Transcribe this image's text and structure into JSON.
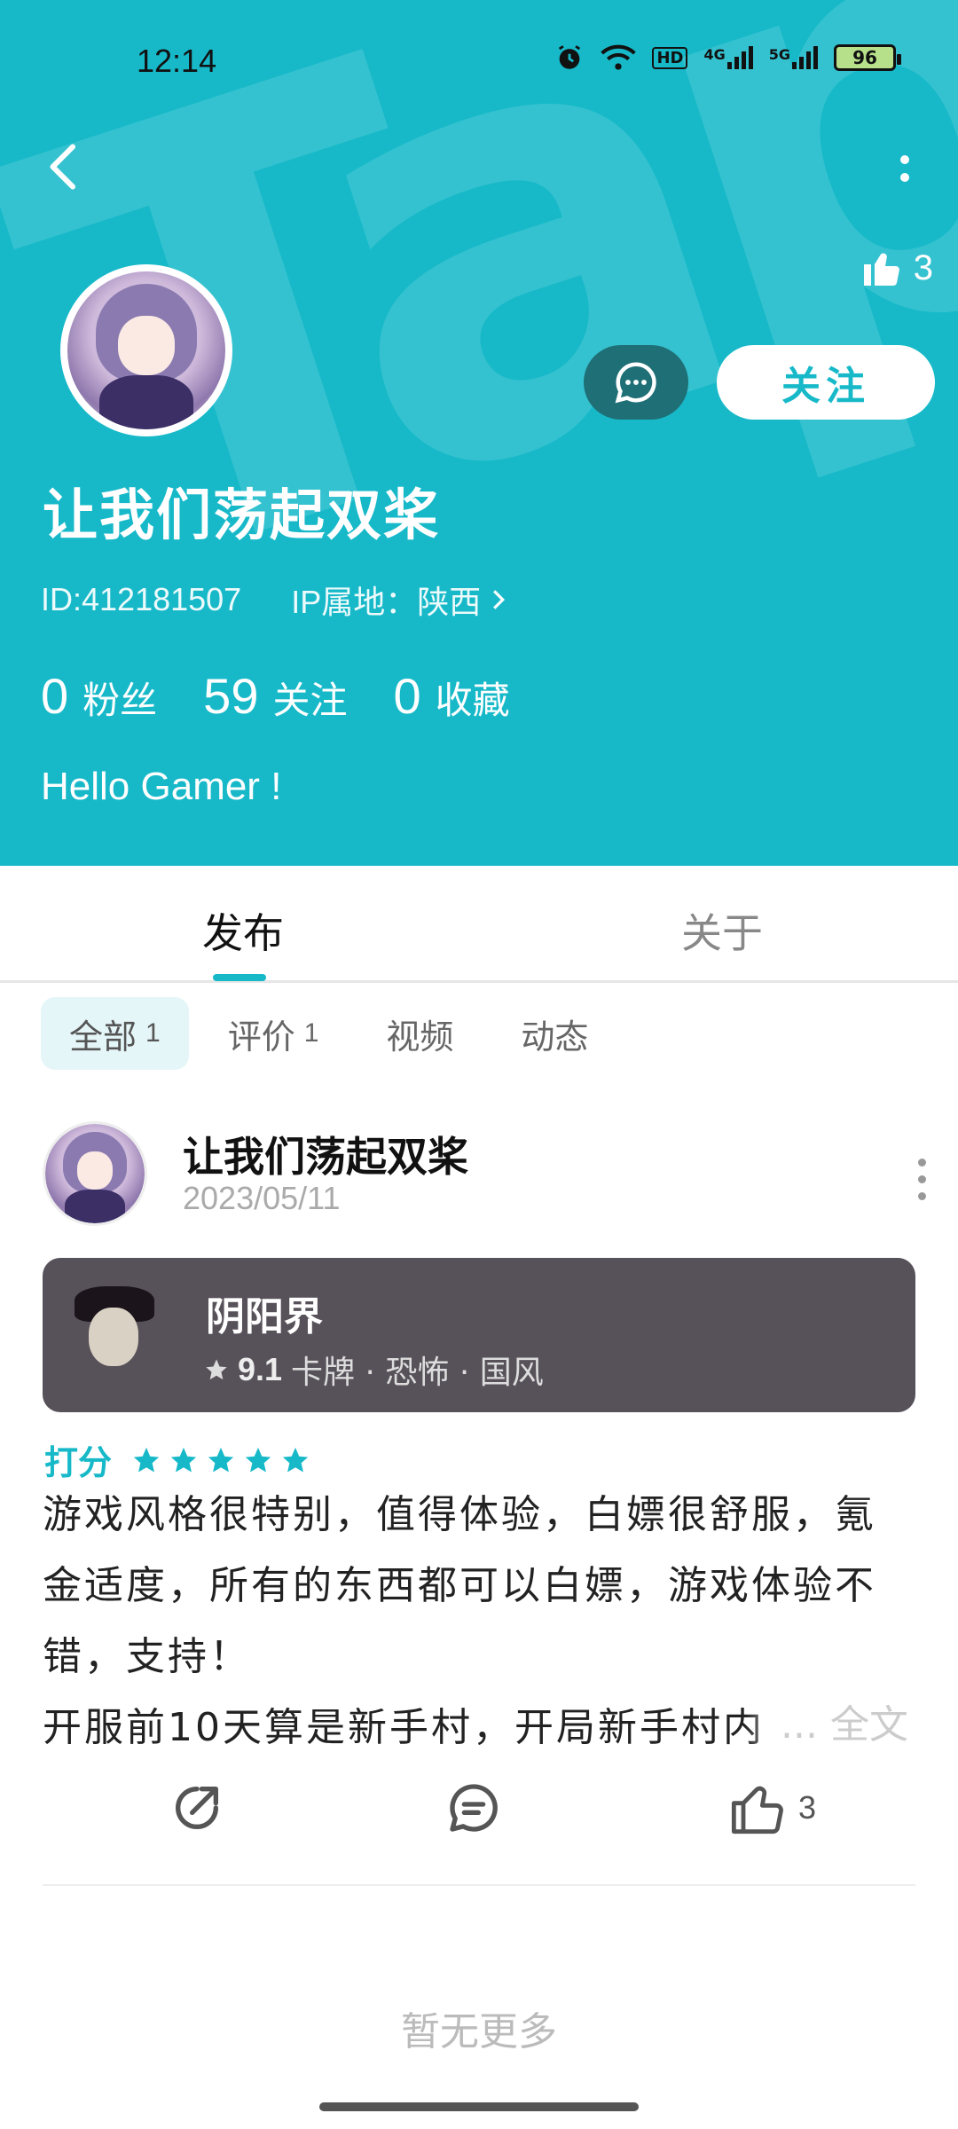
{
  "status_bar": {
    "time": "12:14",
    "network": "HD",
    "signal_1": "4G",
    "signal_2": "5G",
    "battery": "96"
  },
  "header": {
    "likes_count": "3",
    "follow_label": "关注",
    "nickname": "让我们荡起双桨",
    "user_id": "ID:412181507",
    "ip_location": "IP属地：陕西",
    "stats": [
      {
        "num": "0",
        "label": "粉丝"
      },
      {
        "num": "59",
        "label": "关注"
      },
      {
        "num": "0",
        "label": "收藏"
      }
    ],
    "bio": "Hello Gamer !",
    "accent": "#17b9c9"
  },
  "tabs": {
    "publish": "发布",
    "about": "关于"
  },
  "filters": [
    {
      "label": "全部",
      "count": "1"
    },
    {
      "label": "评价",
      "count": "1"
    },
    {
      "label": "视频",
      "count": ""
    },
    {
      "label": "动态",
      "count": ""
    }
  ],
  "post": {
    "author": "让我们荡起双桨",
    "date": "2023/05/11",
    "game": {
      "name": "阴阳界",
      "score": "9.1",
      "tags": "卡牌 · 恐怖 · 国风"
    },
    "rating_label": "打分",
    "stars": 5,
    "lines": [
      "游戏风格很特别，值得体验，白嫖很舒服，氪",
      "金适度，所有的东西都可以白嫖，游戏体验不",
      "错，支持！",
      "开服前10天算是新手村，开局新手村内"
    ],
    "read_more": "... 全文",
    "like_count": "3"
  },
  "footer": {
    "no_more": "暂无更多"
  }
}
